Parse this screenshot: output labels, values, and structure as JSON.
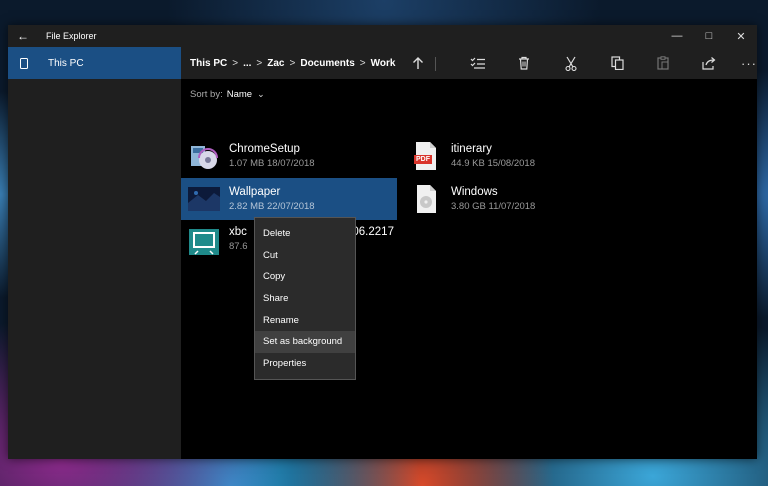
{
  "app": {
    "title": "File Explorer"
  },
  "titlebar": {
    "back_icon": "back-arrow-icon",
    "controls": [
      "minimize",
      "maximize",
      "close"
    ]
  },
  "sidebar": {
    "items": [
      {
        "label": "This PC",
        "icon": "pc-icon",
        "selected": true
      }
    ]
  },
  "breadcrumb": {
    "items": [
      "This PC",
      "...",
      "Zac",
      "Documents",
      "Work"
    ],
    "separator": ">"
  },
  "toolbar": {
    "buttons": [
      "up-arrow",
      "select",
      "delete",
      "cut",
      "copy",
      "paste",
      "share",
      "more"
    ]
  },
  "sort": {
    "label": "Sort by:",
    "value": "Name"
  },
  "files": [
    {
      "name": "ChromeSetup",
      "meta": "1.07 MB 18/07/2018"
    },
    {
      "name": "itinerary",
      "meta": "44.9 KB 15/08/2018",
      "icon_text": "PDF"
    },
    {
      "name": "Wallpaper",
      "meta": "2.82 MB 22/07/2018",
      "selected": true
    },
    {
      "name": "Windows",
      "meta": "3.80 GB 11/07/2018"
    },
    {
      "name": "xbc",
      "name_tail": "806.2217",
      "meta": "87.6"
    }
  ],
  "context_menu": {
    "items": [
      "Delete",
      "Cut",
      "Copy",
      "Share",
      "Rename",
      "Set as background",
      "Properties"
    ],
    "highlighted": "Set as background"
  },
  "colors": {
    "accent": "#1b4f84",
    "chrome": "#1f1f1f",
    "background": "#000000"
  }
}
